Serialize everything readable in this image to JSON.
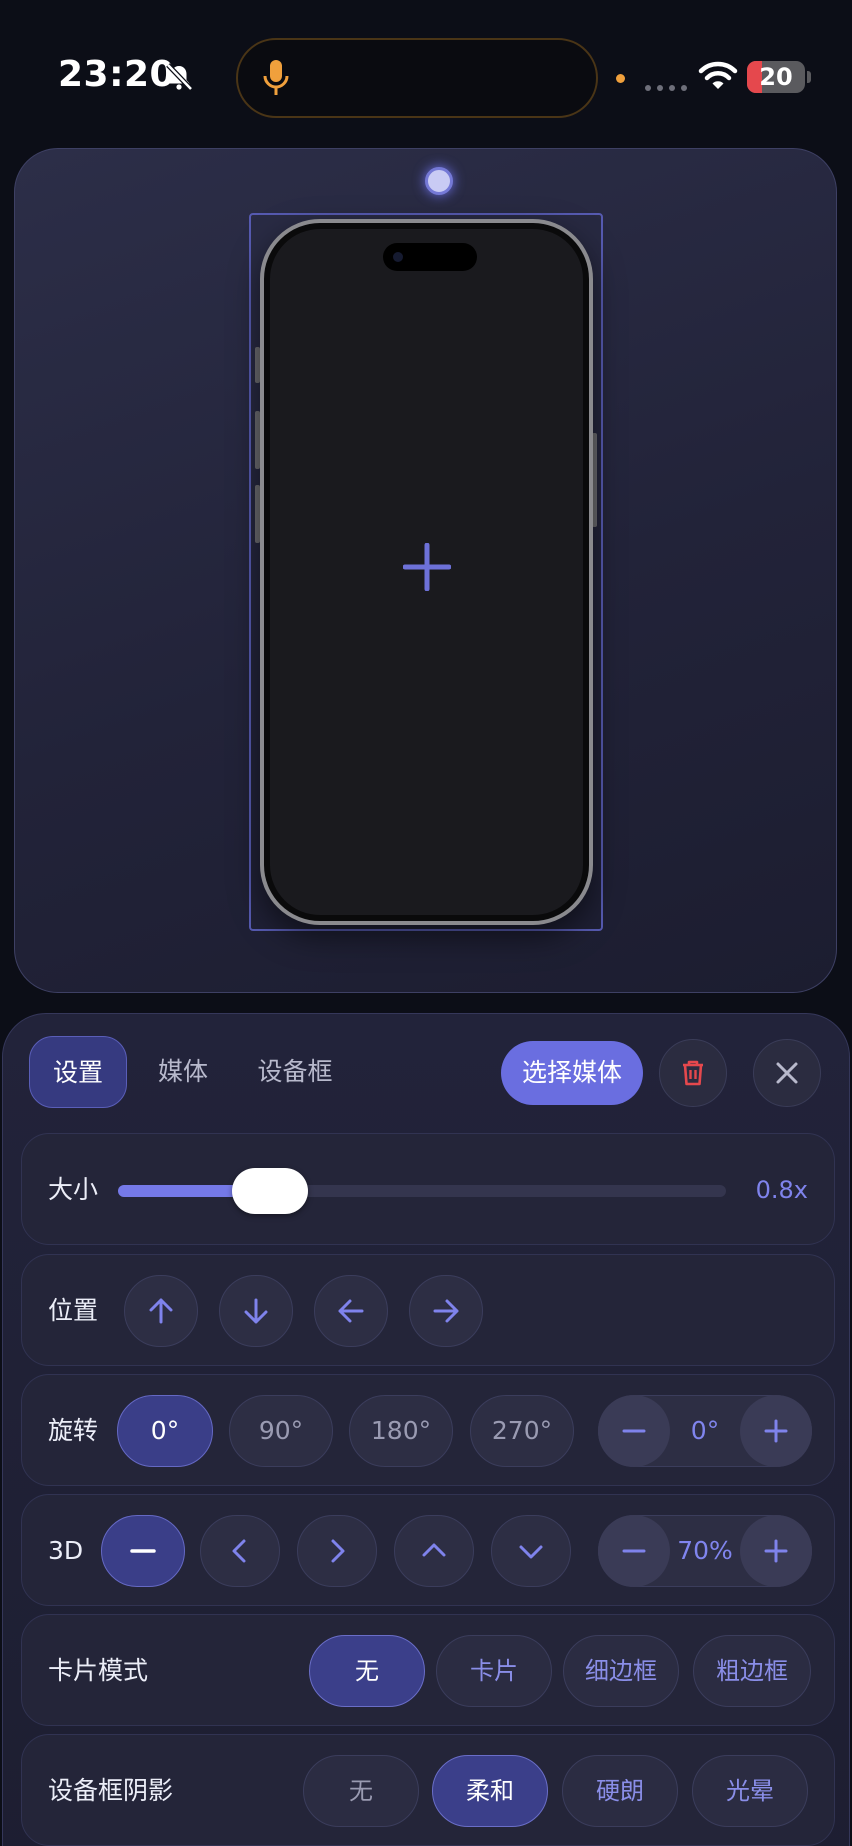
{
  "status": {
    "time": "23:20",
    "battery": "20"
  },
  "tabs": [
    {
      "label": "设置"
    },
    {
      "label": "媒体"
    },
    {
      "label": "设备框"
    }
  ],
  "actions": {
    "pick_media": "选择媒体"
  },
  "size": {
    "label": "大小",
    "value_text": "0.8x",
    "fraction": 0.25
  },
  "position": {
    "label": "位置"
  },
  "rotation": {
    "label": "旋转",
    "options": [
      "0°",
      "90°",
      "180°",
      "270°"
    ],
    "selected": "0°",
    "stepper_value": "0°"
  },
  "three_d": {
    "label": "3D",
    "stepper_value": "70%"
  },
  "card_mode": {
    "label": "卡片模式",
    "options": [
      "无",
      "卡片",
      "细边框",
      "粗边框"
    ],
    "selected": "无"
  },
  "frame_shadow": {
    "label": "设备框阴影",
    "options": [
      "无",
      "柔和",
      "硬朗",
      "光晕"
    ],
    "selected": "柔和"
  },
  "colors": {
    "accent": "#6a6ee0",
    "delete": "#e5484d",
    "mic": "#f0a03c"
  }
}
